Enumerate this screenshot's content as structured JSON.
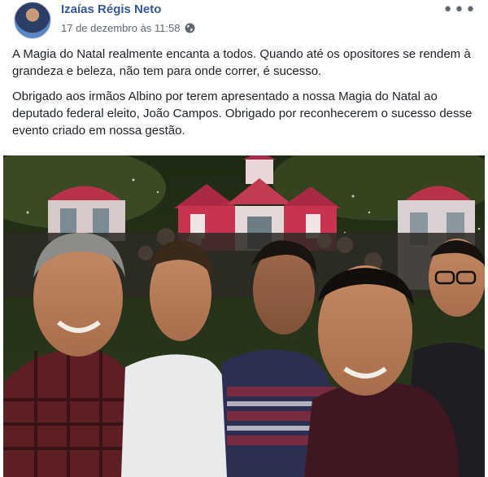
{
  "post": {
    "author": "Izaías Régis Neto",
    "timestamp": "17 de dezembro às 11:58",
    "privacy_icon": "globe-icon",
    "menu_icon": "more-dots-icon",
    "menu_glyph": "•••",
    "paragraphs": [
      "A Magia do Natal realmente encanta a todos. Quando até os opositores se rendem à grandeza e beleza, não tem para onde correr, é sucesso.",
      "Obrigado aos irmãos Albino por terem apresentado a nossa Magia do Natal ao deputado federal eleito, João Campos. Obrigado por reconhecerem o sucesso desse evento criado em nossa gestão."
    ]
  },
  "colors": {
    "author_link": "#385898",
    "meta_text": "#616770",
    "body_text": "#1d2129"
  }
}
